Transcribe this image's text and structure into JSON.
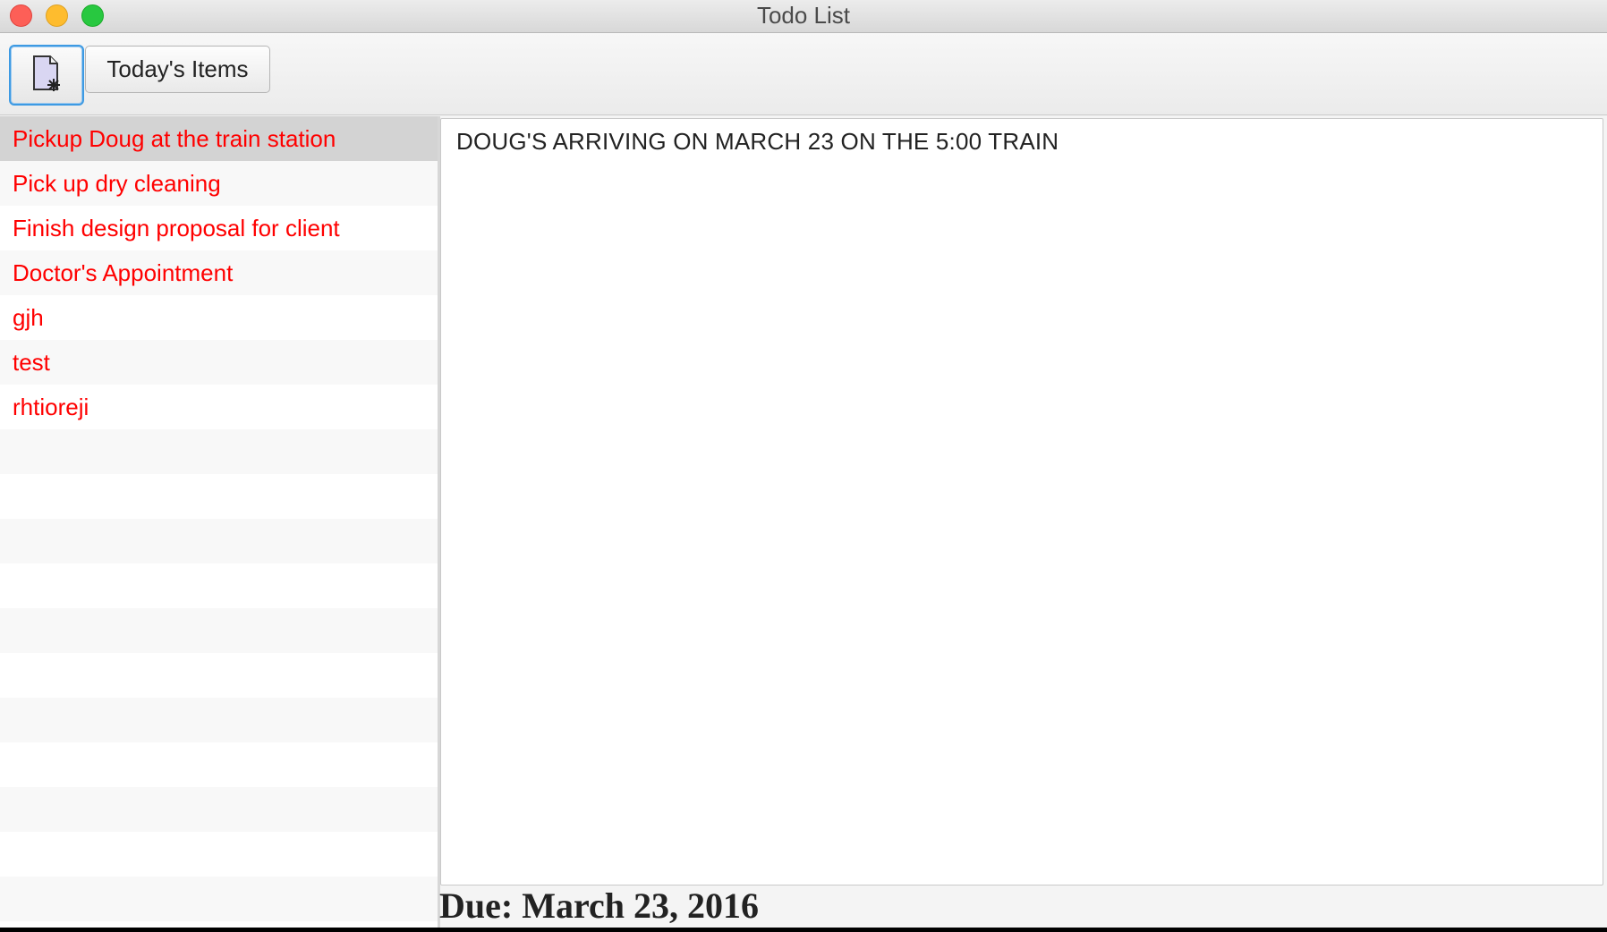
{
  "window": {
    "title": "Todo List"
  },
  "toolbar": {
    "new_item_icon": "new-document-icon",
    "today_label": "Today's Items"
  },
  "todo_items": [
    {
      "label": "Pickup Doug at the train station",
      "selected": true
    },
    {
      "label": "Pick up dry cleaning",
      "selected": false
    },
    {
      "label": "Finish design proposal for client",
      "selected": false
    },
    {
      "label": "Doctor's Appointment",
      "selected": false
    },
    {
      "label": "gjh",
      "selected": false
    },
    {
      "label": "test",
      "selected": false
    },
    {
      "label": "rhtioreji",
      "selected": false
    }
  ],
  "details": {
    "text": "DOUG'S ARRIVING ON MARCH 23 ON THE 5:00 TRAIN",
    "due_label": "Due: March 23, 2016"
  },
  "colors": {
    "item_text": "#ff0000",
    "selected_row": "#d3d3d3",
    "focus_ring": "#3d9ae3"
  }
}
